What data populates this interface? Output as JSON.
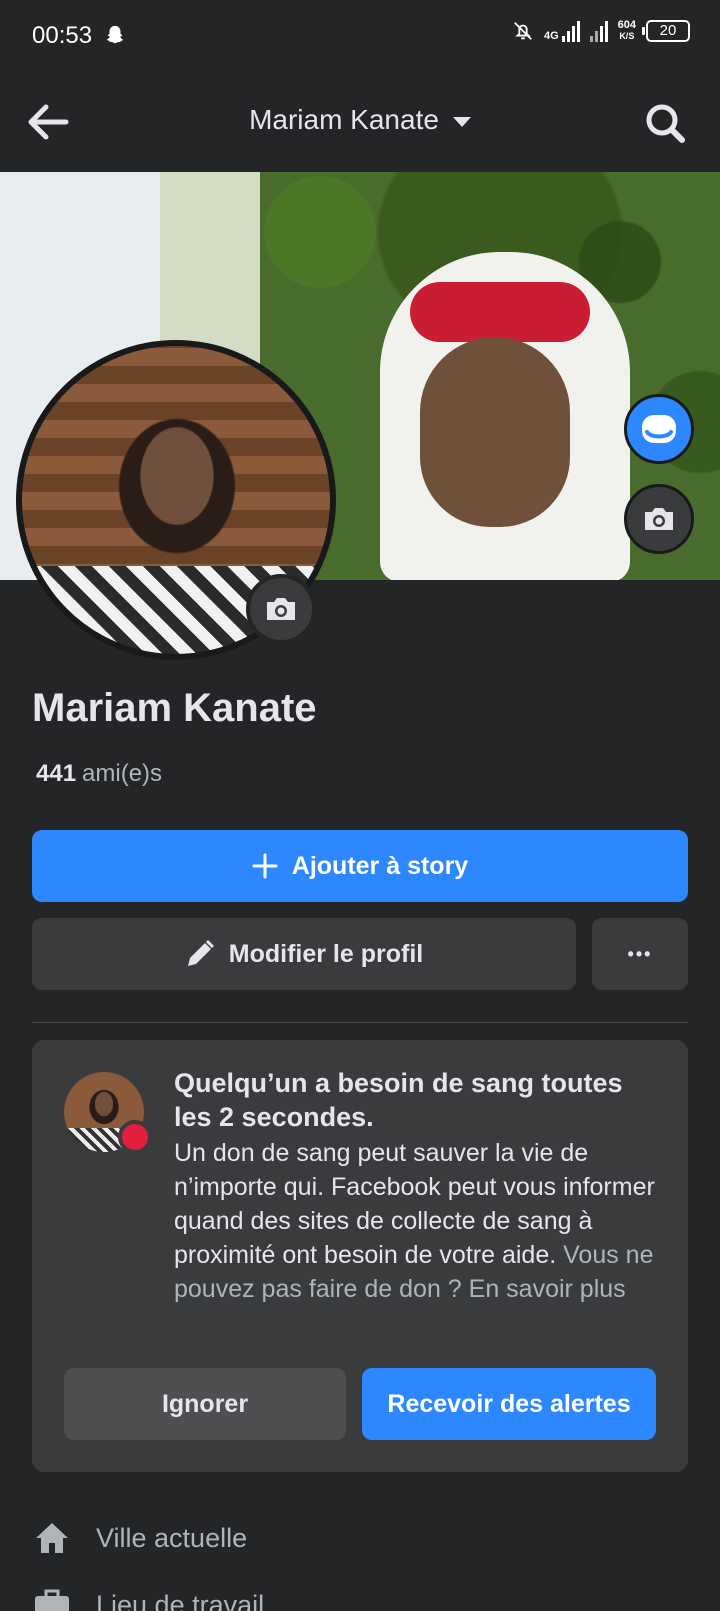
{
  "status_bar": {
    "time": "00:53",
    "network": "4G",
    "speed_value": "604",
    "speed_unit": "K/S",
    "battery": "20"
  },
  "header": {
    "title": "Mariam Kanate"
  },
  "profile": {
    "name": "Mariam Kanate",
    "friends_count": "441",
    "friends_label": "ami(e)s"
  },
  "actions": {
    "add_story": "Ajouter à story",
    "edit_profile": "Modifier le profil",
    "more": "•••"
  },
  "blood_card": {
    "title": "Quelqu’un a besoin de sang toutes les 2 secondes.",
    "body": "Un don de sang peut sauver la vie de n’importe qui. Facebook peut vous informer quand des sites de collecte de sang à proximité ont besoin de votre aide.",
    "link": "Vous ne pouvez pas faire de don ? En savoir plus",
    "ignore": "Ignorer",
    "alerts": "Recevoir des alertes"
  },
  "details": [
    {
      "icon": "home-icon",
      "label": "Ville actuelle"
    },
    {
      "icon": "briefcase-icon",
      "label": "Lieu de travail"
    }
  ],
  "colors": {
    "accent": "#2d88ff",
    "background": "#242526",
    "card": "#3a3b3c",
    "alert_dot": "#e41e3f"
  }
}
